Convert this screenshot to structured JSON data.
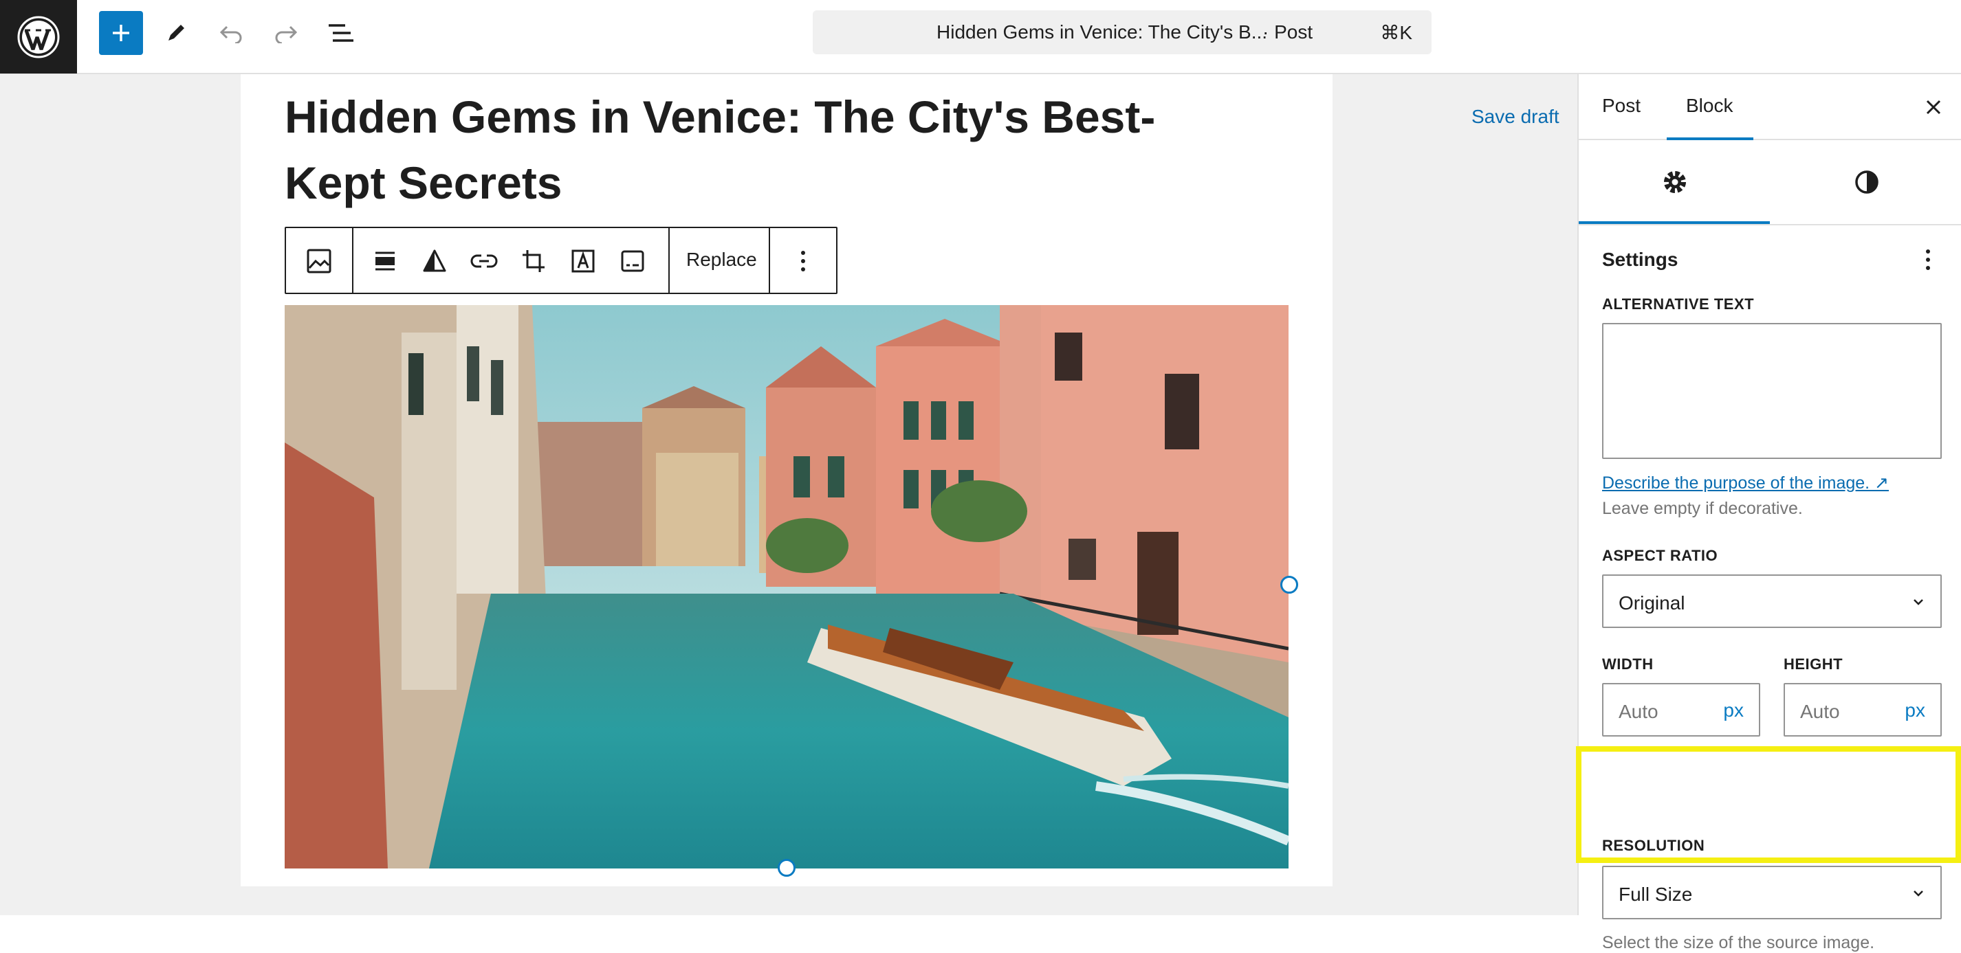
{
  "header": {
    "document_title": "Hidden Gems in Venice: The City's B...",
    "document_type": "· Post",
    "shortcut": "⌘K"
  },
  "post": {
    "title": "Hidden Gems in Venice: The City's Best-Kept Secrets",
    "save_draft_label": "Save draft"
  },
  "block_toolbar": {
    "replace_label": "Replace"
  },
  "sidebar": {
    "tabs": [
      {
        "label": "Post"
      },
      {
        "label": "Block"
      }
    ],
    "settings_title": "Settings",
    "alt_text": {
      "label": "ALTERNATIVE TEXT",
      "value": "",
      "link_text": "Describe the purpose of the image. ↗",
      "help": "Leave empty if decorative."
    },
    "aspect_ratio": {
      "label": "ASPECT RATIO",
      "value": "Original"
    },
    "width": {
      "label": "WIDTH",
      "placeholder": "Auto",
      "unit": "px"
    },
    "height": {
      "label": "HEIGHT",
      "placeholder": "Auto",
      "unit": "px"
    },
    "resolution": {
      "label": "RESOLUTION",
      "value": "Full Size",
      "help": "Select the size of the source image."
    }
  },
  "colors": {
    "accent": "#0a7bc2",
    "highlight": "#f5ef12"
  }
}
